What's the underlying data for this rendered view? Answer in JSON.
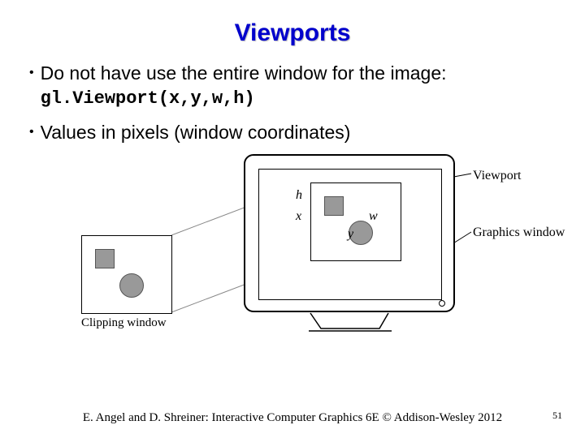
{
  "title": "Viewports",
  "bullets": [
    {
      "prefix": "Do not have use the entire window for the image: ",
      "code": "gl.Viewport(x,y,w,h)"
    },
    {
      "prefix": "Values in pixels (window coordinates)",
      "code": ""
    }
  ],
  "diagram": {
    "clipping_label": "Clipping window",
    "viewport_label": "Viewport",
    "graphics_label": "Graphics window",
    "h": "h",
    "x": "x",
    "w": "w",
    "y": "y"
  },
  "footer": "E. Angel and D. Shreiner: Interactive Computer Graphics 6E © Addison-Wesley 2012",
  "page": "51"
}
